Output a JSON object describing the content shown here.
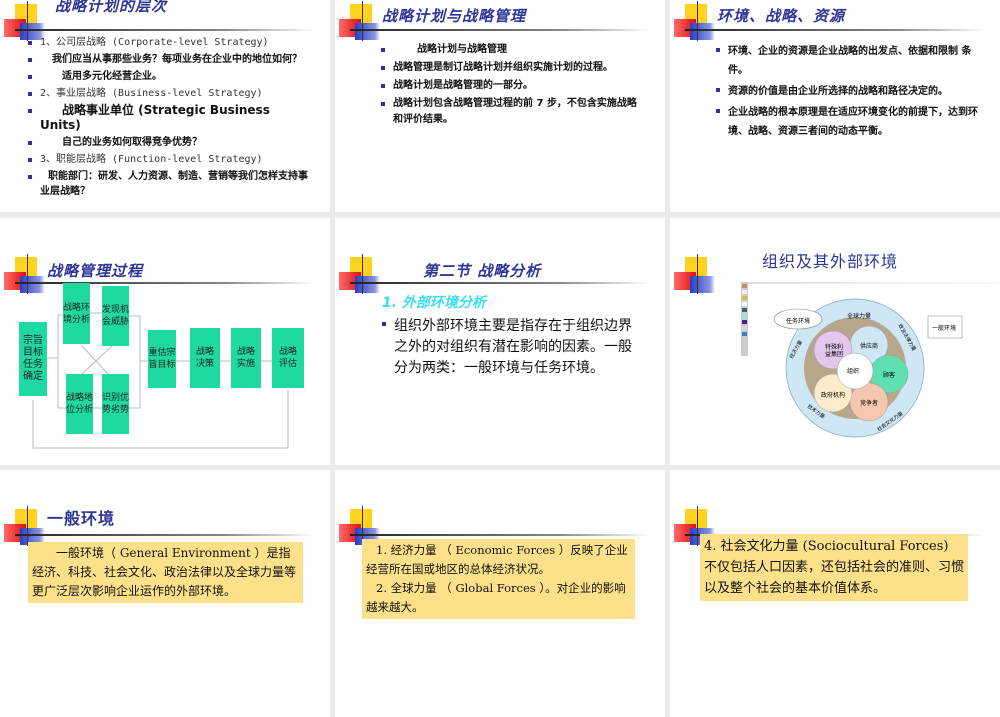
{
  "slides": [
    {
      "title": "战略计划的层次",
      "items": [
        "1、公司层战略 (Corporate-level Strategy)",
        "我们应当从事那些业务？每项业务在企业中的地位如何？",
        "适用多元化经营企业。",
        "2、事业层战略 (Business-level Strategy)",
        "战略事业单位 (Strategic Business Units)",
        "自己的业务如何取得竞争优势？",
        "3、职能层战略 (Function-level Strategy)",
        "职能部门：研发、人力资源、制造、营销等我们怎样支持事业层战略？"
      ]
    },
    {
      "title": "战略计划与战略管理",
      "items": [
        "战略计划与战略管理",
        "战略管理是制订战略计划并组织实施计划的过程。",
        "战略计划是战略管理的一部分。",
        "战略计划包含战略管理过程的前 7 步，不包含实施战略和评价结果。"
      ]
    },
    {
      "title": "环境、战略、资源",
      "items": [
        "环境、企业的资源是企业战略的出发点、依据和限制  条件。",
        "资源的价值是由企业所选择的战略和路径决定的。",
        "企业战略的根本原理是在适应环境变化的前提下，达到环境、战略、资源三者间的动态平衡。"
      ]
    },
    {
      "title": "战略管理过程",
      "boxes": [
        "宗旨目标任务确定",
        "战略环境分析",
        "发现机会威胁",
        "战略地位分析",
        "识别优势劣势",
        "重估宗旨目标",
        "战略决策",
        "战略实施",
        "战略评估"
      ]
    },
    {
      "title": "第二节 战略分析",
      "subtitle": "1. 外部环境分析",
      "items": [
        "组织外部环境主要是指存在于组织边界之外的对组织有潜在影响的因素。一般分为两类：一般环境与任务环境。"
      ]
    },
    {
      "title": "组织及其外部环境",
      "diagram": {
        "task_env": "任务环境",
        "general_env": "一般环境",
        "center": "组织",
        "petals": [
          "供应商",
          "顾客",
          "竞争者",
          "政府机构",
          "特殊利益集团"
        ],
        "ring": [
          "全球力量",
          "政治法律力量",
          "社会文化力量",
          "技术力量",
          "经济力量"
        ]
      }
    },
    {
      "title": "一般环境",
      "text": "　　一般环境（ General Environment ）是指经济、科技、社会文化、政治法律以及全球力量等更广泛层次影响企业运作的外部环境。"
    },
    {
      "items": [
        "1. 经济力量 （ Economic Forces ）反映了企业经营所在国或地区的总体经济状况。",
        "2. 全球力量 （ Global Forces ）。对企业的影响越来越大。"
      ]
    },
    {
      "items": [
        "4. 社会文化力量 (Sociocultural Forces) 不仅包括人口因素，还包括社会的准则、习惯以及整个社会的基本价值体系。"
      ]
    }
  ],
  "colors": {
    "title": "#2e3596",
    "flow_box": "#1ed9a0",
    "highlight_box": "#fde08a",
    "subtitle": "#38e0f0"
  }
}
